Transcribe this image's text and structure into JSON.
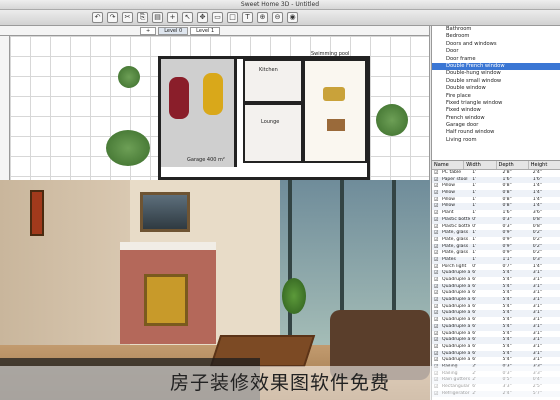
{
  "window": {
    "title": "Sweet Home 3D - Untitled"
  },
  "toolbar": {
    "icons": [
      "undo-icon",
      "redo-icon",
      "cut-icon",
      "copy-icon",
      "paste-icon",
      "add-icon",
      "select-icon",
      "pan-icon",
      "wall-icon",
      "room-icon",
      "text-icon",
      "zoom-in-icon",
      "zoom-out-icon",
      "camera-icon"
    ]
  },
  "plan": {
    "tabs": [
      {
        "label": "+"
      },
      {
        "label": "Level 0"
      },
      {
        "label": "Level 1"
      }
    ],
    "labels": {
      "swimming_pool": "Swimming pool",
      "kitchen": "Kitchen",
      "garage": "Garage 400 m²",
      "lounge": "Lounge"
    }
  },
  "catalog": {
    "items": [
      "Bathroom",
      "Bedroom",
      "Doors and windows",
      "Door",
      "Door frame",
      "Double French window",
      "Double-hung window",
      "Double small window",
      "Double window",
      "Fire place",
      "Fixed triangle window",
      "Fixed window",
      "French window",
      "Garage door",
      "Half round window",
      "Living room"
    ],
    "selected_index": 5
  },
  "furniture": {
    "columns": [
      "Name",
      "Width",
      "Depth",
      "Height"
    ],
    "rows": [
      [
        "PC table",
        "1'",
        "2'8\"",
        "2'4\""
      ],
      [
        "Paper stool",
        "1'",
        "1'6\"",
        "1'6\""
      ],
      [
        "Pillow",
        "1'",
        "0'8\"",
        "1'4\""
      ],
      [
        "Pillow",
        "1'",
        "0'8\"",
        "1'4\""
      ],
      [
        "Pillow",
        "1'",
        "0'8\"",
        "1'4\""
      ],
      [
        "Pillow",
        "1'",
        "0'8\"",
        "1'4\""
      ],
      [
        "Plant",
        "1'",
        "1'6\"",
        "3'6\""
      ],
      [
        "Plastic bottle",
        "0'",
        "0'3\"",
        "0'8\""
      ],
      [
        "Plastic bottle",
        "0'",
        "0'3\"",
        "0'8\""
      ],
      [
        "Plate, glass a...",
        "1'",
        "0'9\"",
        "0'2\""
      ],
      [
        "Plate, glass a...",
        "1'",
        "0'9\"",
        "0'2\""
      ],
      [
        "Plate, glass a...",
        "1'",
        "0'9\"",
        "0'2\""
      ],
      [
        "Plate, glass a...",
        "1'",
        "0'9\"",
        "0'2\""
      ],
      [
        "Plates",
        "1'",
        "1'1\"",
        "0'3\""
      ],
      [
        "Porch light",
        "0'",
        "0'7\"",
        "1'4\""
      ],
      [
        "Quadruple appli...",
        "6'",
        "5'4\"",
        "3'1\""
      ],
      [
        "Quadruple appli...",
        "6'",
        "5'4\"",
        "3'1\""
      ],
      [
        "Quadruple appli...",
        "6'",
        "5'4\"",
        "3'1\""
      ],
      [
        "Quadruple appli...",
        "6'",
        "5'4\"",
        "3'1\""
      ],
      [
        "Quadruple appli...",
        "6'",
        "5'4\"",
        "3'1\""
      ],
      [
        "Quadruple appli...",
        "6'",
        "5'4\"",
        "3'1\""
      ],
      [
        "Quadruple appli...",
        "6'",
        "5'4\"",
        "3'1\""
      ],
      [
        "Quadruple appli...",
        "6'",
        "5'4\"",
        "3'1\""
      ],
      [
        "Quadruple appli...",
        "6'",
        "5'4\"",
        "3'1\""
      ],
      [
        "Quadruple appli...",
        "6'",
        "5'4\"",
        "3'1\""
      ],
      [
        "Quadruple appli...",
        "6'",
        "5'4\"",
        "3'1\""
      ],
      [
        "Quadruple appli...",
        "6'",
        "5'4\"",
        "3'1\""
      ],
      [
        "Quadruple appli...",
        "6'",
        "5'4\"",
        "3'1\""
      ],
      [
        "Quadruple appli...",
        "6'",
        "5'4\"",
        "3'1\""
      ],
      [
        "Railing",
        "2'",
        "0'3\"",
        "3'3\""
      ],
      [
        "Railing",
        "2'",
        "0'3\"",
        "3'3\""
      ],
      [
        "Rain gutters",
        "2'",
        "0'5\"",
        "0'4\""
      ],
      [
        "Rectangular tab...",
        "6'",
        "3'3\"",
        "2'5\""
      ],
      [
        "Refrigerator",
        "2'",
        "2'4\"",
        "5'7\""
      ]
    ]
  },
  "caption": "房子装修效果图软件免费",
  "colors": {
    "selection": "#3a76d4",
    "car_red": "#8a1e2a",
    "car_yellow": "#d9a81a"
  }
}
